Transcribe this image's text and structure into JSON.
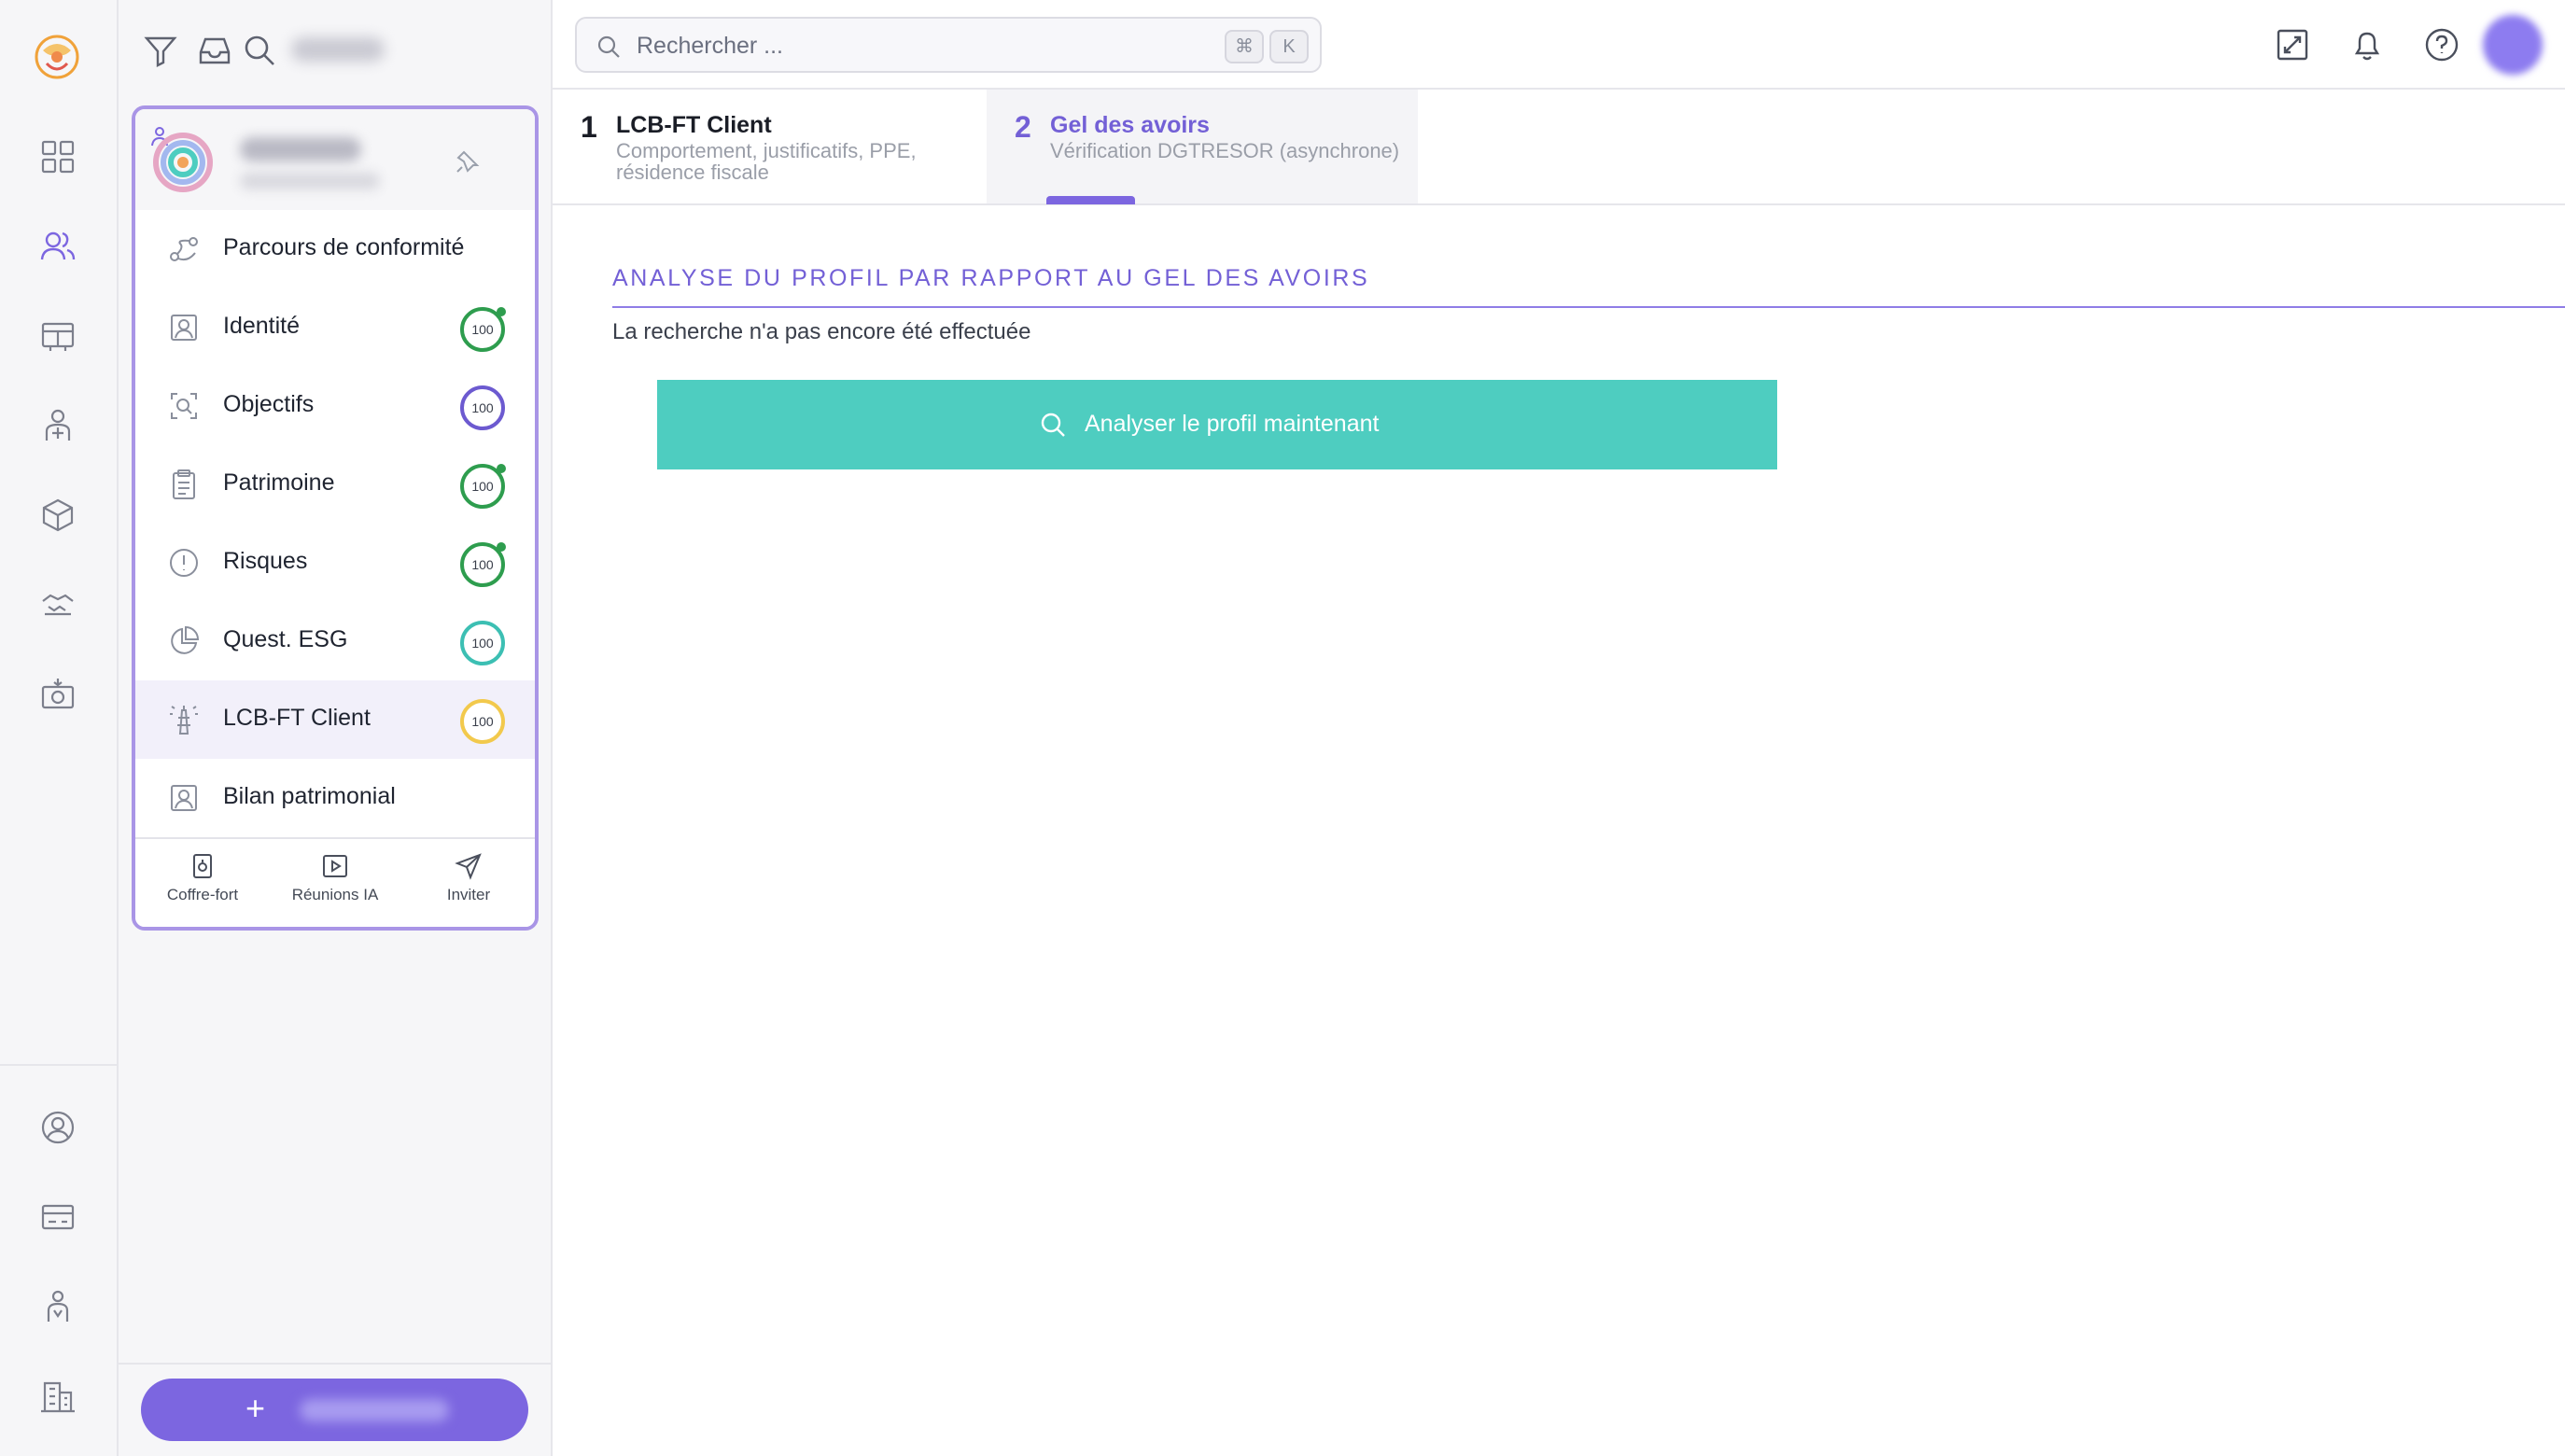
{
  "colors": {
    "accent": "#7c66e0",
    "accent_text": "#7360d6",
    "action_button": "#4ecdc0",
    "score_green": "#2e9d4e",
    "score_purple": "#6c5ad0",
    "score_teal": "#3cbfb3",
    "score_yellow": "#f2c94c"
  },
  "rail": {
    "icons": [
      "app-logo",
      "dashboard-icon",
      "clients-icon",
      "board-icon",
      "advisor-icon",
      "products-icon",
      "handshake-icon",
      "camera-icon",
      "account-icon",
      "billing-icon",
      "team-icon",
      "building-icon"
    ]
  },
  "client_panel": {
    "toolbar_icons": [
      "filter-icon",
      "inbox-icon",
      "search-icon"
    ],
    "menu": [
      {
        "label": "Parcours de conformité",
        "icon": "route-icon"
      },
      {
        "label": "Identité",
        "icon": "id-card-icon",
        "score": "100",
        "score_color": "green",
        "dot": true
      },
      {
        "label": "Objectifs",
        "icon": "target-icon",
        "score": "100",
        "score_color": "purple",
        "dot": false
      },
      {
        "label": "Patrimoine",
        "icon": "clipboard-icon",
        "score": "100",
        "score_color": "green",
        "dot": true
      },
      {
        "label": "Risques",
        "icon": "alert-icon",
        "score": "100",
        "score_color": "green",
        "dot": true
      },
      {
        "label": "Quest. ESG",
        "icon": "pie-icon",
        "score": "100",
        "score_color": "teal",
        "dot": false
      },
      {
        "label": "LCB-FT Client",
        "icon": "tower-icon",
        "score": "100",
        "score_color": "yellow",
        "dot": false
      },
      {
        "label": "Bilan patrimonial",
        "icon": "portrait-icon"
      }
    ],
    "footer": [
      {
        "label": "Coffre-fort",
        "icon": "safe-icon"
      },
      {
        "label": "Réunions IA",
        "icon": "video-icon"
      },
      {
        "label": "Inviter",
        "icon": "send-icon"
      }
    ],
    "add_button_plus": "+"
  },
  "topbar": {
    "search_placeholder": "Rechercher ...",
    "kbd_cmd": "⌘",
    "kbd_k": "K",
    "icons": [
      "expand-icon",
      "bell-icon",
      "help-icon"
    ]
  },
  "steps": [
    {
      "number": "1",
      "title": "LCB-FT Client",
      "subtitle": "Comportement, justificatifs, PPE, résidence fiscale",
      "active": false
    },
    {
      "number": "2",
      "title": "Gel des avoirs",
      "subtitle": "Vérification DGTRESOR (asynchrone)",
      "active": true
    }
  ],
  "main": {
    "section_title": "ANALYSE DU PROFIL PAR RAPPORT AU GEL DES AVOIRS",
    "status": "La recherche n'a pas encore été effectuée",
    "analyze_button": "Analyser le profil maintenant"
  }
}
